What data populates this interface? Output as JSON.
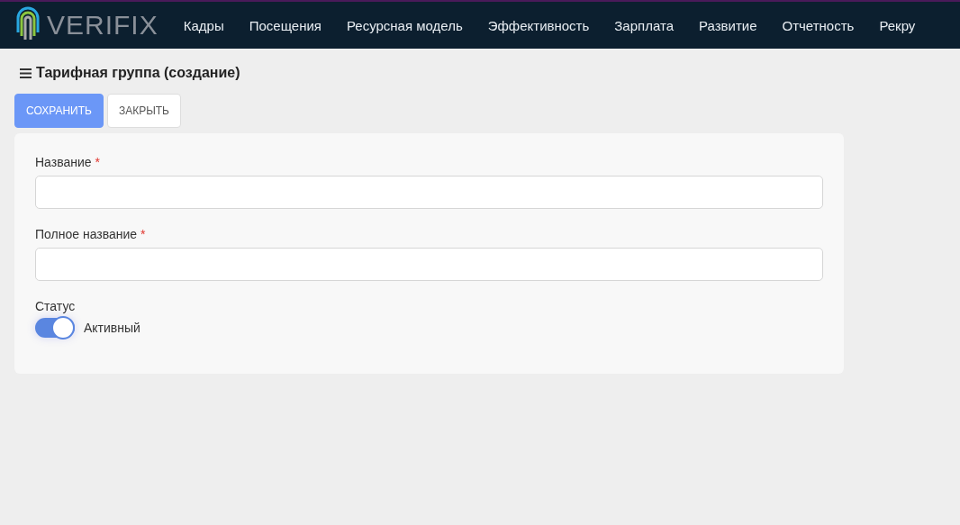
{
  "logo": {
    "text": "VERIFIX"
  },
  "nav": [
    {
      "label": "Кадры"
    },
    {
      "label": "Посещения"
    },
    {
      "label": "Ресурсная модель"
    },
    {
      "label": "Эффективность"
    },
    {
      "label": "Зарплата"
    },
    {
      "label": "Развитие"
    },
    {
      "label": "Отчетность"
    },
    {
      "label": "Рекру"
    }
  ],
  "page_title": "Тарифная группа (создание)",
  "buttons": [
    {
      "label": "СОХРАНИТЬ",
      "kind": "primary"
    },
    {
      "label": "ЗАКРЫТЬ",
      "kind": "secondary"
    }
  ],
  "fields": [
    {
      "label": "Название",
      "required_mark": "*"
    },
    {
      "label": "Полное название",
      "required_mark": "*"
    }
  ],
  "status": {
    "label": "Статус",
    "on": true,
    "text": "Активный"
  }
}
